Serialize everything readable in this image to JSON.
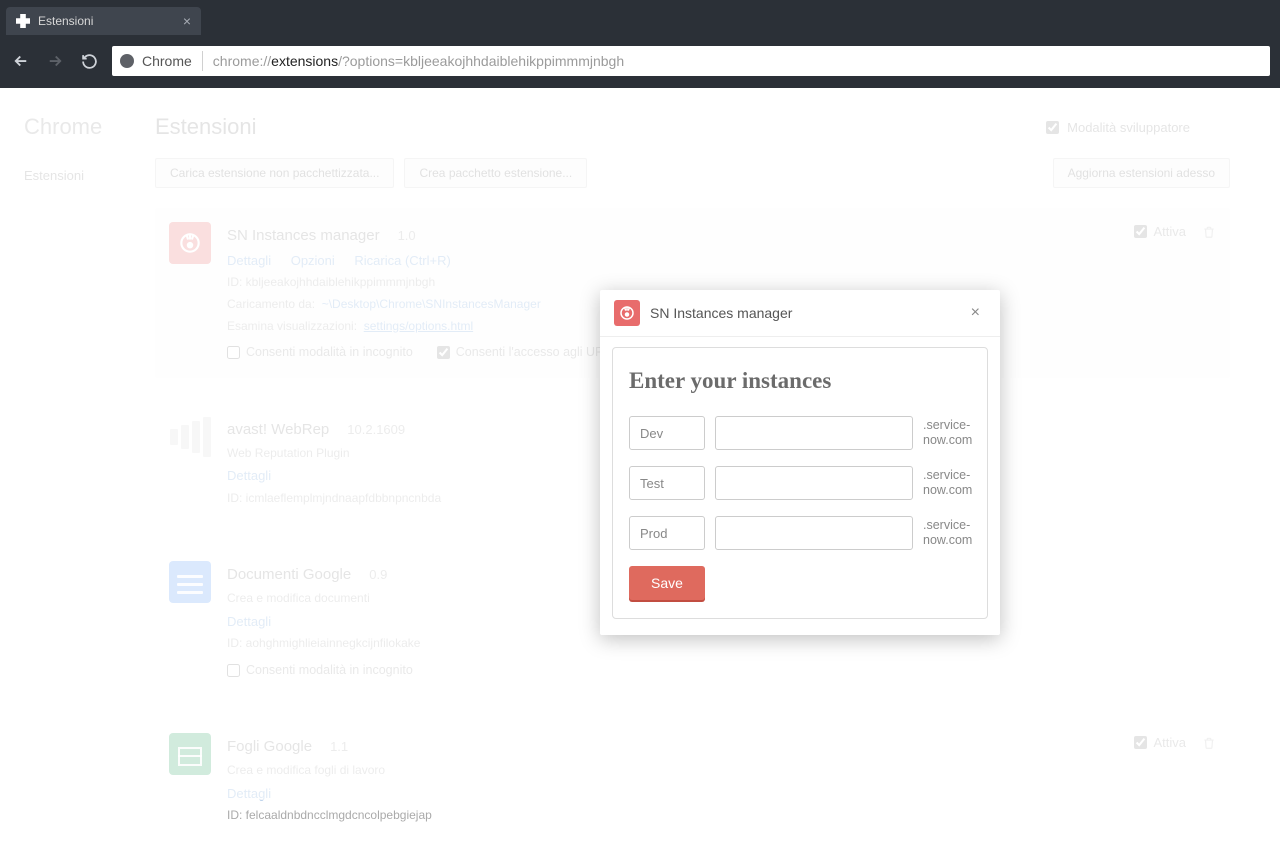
{
  "browser": {
    "tab_title": "Estensioni",
    "chrome_label": "Chrome",
    "url_prefix": "chrome://",
    "url_highlight": "extensions",
    "url_suffix": "/?options=kbljeeakojhhdaiblehikppimmmjnbgh"
  },
  "sidebar": {
    "title": "Chrome",
    "item": "Estensioni"
  },
  "page": {
    "title": "Estensioni",
    "dev_mode": "Modalità sviluppatore",
    "btn_load": "Carica estensione non pacchettizzata...",
    "btn_pack": "Crea pacchetto estensione...",
    "btn_update": "Aggiorna estensioni adesso"
  },
  "ext1": {
    "name": "SN Instances manager",
    "version": "1.0",
    "link_details": "Dettagli",
    "link_options": "Opzioni",
    "link_reload": "Ricarica (Ctrl+R)",
    "id": "ID: kbljeeakojhhdaiblehikppimmmjnbgh",
    "load_label": "Caricamento da:",
    "load_path": "~\\Desktop\\Chrome\\SNInstancesManager",
    "inspect_label": "Esamina visualizzazioni:",
    "inspect_link": "settings/options.html",
    "chk_incognito": "Consenti modalità in incognito",
    "chk_fileurl": "Consenti l'accesso agli URL dei file",
    "active": "Attiva"
  },
  "ext2": {
    "name": "avast! WebRep",
    "version": "10.2.1609",
    "desc": "Web Reputation Plugin",
    "link_details": "Dettagli",
    "id": "ID: icmlaeflemplmjndnaapfdbbnpncnbda"
  },
  "ext3": {
    "name": "Documenti Google",
    "version": "0.9",
    "desc": "Crea e modifica documenti",
    "link_details": "Dettagli",
    "id": "ID: aohghmighlieiainnegkcijnfilokake",
    "chk_incognito": "Consenti modalità in incognito"
  },
  "ext4": {
    "name": "Fogli Google",
    "version": "1.1",
    "desc": "Crea e modifica fogli di lavoro",
    "link_details": "Dettagli",
    "id": "ID: felcaaldnbdncclmgdcncolpebgiejap",
    "active": "Attiva"
  },
  "modal": {
    "title": "SN Instances manager",
    "heading": "Enter your instances",
    "rows": [
      {
        "label": "Dev",
        "suffix": ".service-now.com"
      },
      {
        "label": "Test",
        "suffix": ".service-now.com"
      },
      {
        "label": "Prod",
        "suffix": ".service-now.com"
      }
    ],
    "save": "Save"
  }
}
